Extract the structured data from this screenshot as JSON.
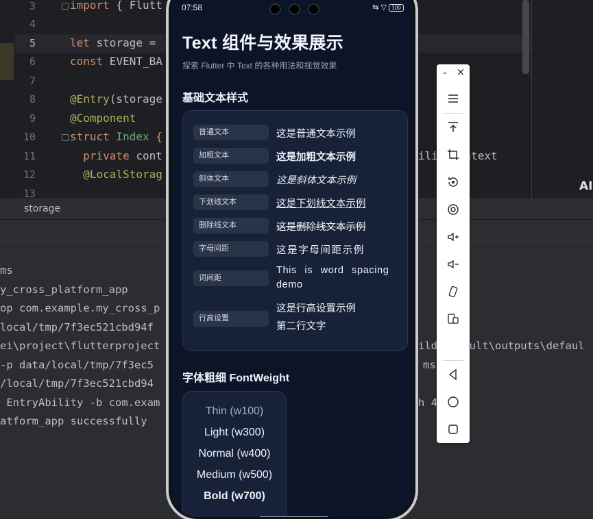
{
  "ide": {
    "line_numbers": [
      "3",
      "4",
      "5",
      "6",
      "7",
      "8",
      "9",
      "10",
      "11",
      "12",
      "13"
    ],
    "code": {
      "l3_kw": "import",
      "l3_rest": " { Flutt",
      "l5_kw": "let",
      "l5_rest": " storage = ",
      "l6_kw": "const",
      "l6_rest": " EVENT_BA",
      "l8_an": "@Entry",
      "l8_rest": "(storage",
      "l9_an": "@Component",
      "l10_kw": "struct",
      "l10_ty": " Index ",
      "l10_rest": "{",
      "l11_kw": "  private",
      "l11_rest": " cont",
      "l11_right": "ilityContext",
      "l12_an": "  @LocalStorag"
    },
    "right_pane_text": "AI",
    "breadcrumb": "storage",
    "console_lines": [
      "ms",
      "y_cross_platform_app",
      "op com.example.my_cross_p",
      "local/tmp/7f3ec521cbd94f",
      "ei\\project\\flutterproject",
      "-p data/local/tmp/7f3ec5",
      "/local/tmp/7f3ec521cbd94",
      " EntryAbility -b com.exam",
      "atform_app successfully "
    ],
    "console_right": [
      "ild\\default\\outputs\\defaul",
      "ms",
      "h 4 ms"
    ]
  },
  "phone": {
    "status_time": "07:58",
    "status_icons": "⇆ ▽",
    "battery": "100",
    "title": "Text 组件与效果展示",
    "subtitle": "探索 Flutter 中 Text 的各种用法和视觉效果",
    "basic_section_title": "基础文本样式",
    "rows": [
      {
        "label": "普通文本",
        "sample": "这是普通文本示例"
      },
      {
        "label": "加粗文本",
        "sample": "这是加粗文本示例"
      },
      {
        "label": "斜体文本",
        "sample": "这是斜体文本示例"
      },
      {
        "label": "下划线文本",
        "sample": "这是下划线文本示例"
      },
      {
        "label": "删除线文本",
        "sample": "这是删除线文本示例"
      },
      {
        "label": "字母间距",
        "sample": "这是字母间距示例"
      },
      {
        "label": "词间距",
        "sample": "This is word spacing demo"
      },
      {
        "label": "行高设置",
        "sample_line1": "这是行高设置示例",
        "sample_line2": "第二行文字"
      }
    ],
    "weight_section_title": "字体粗细 FontWeight",
    "weights": [
      {
        "label": "Thin (w100)",
        "weight": 100
      },
      {
        "label": "Light (w300)",
        "weight": 300
      },
      {
        "label": "Normal (w400)",
        "weight": 400
      },
      {
        "label": "Medium (w500)",
        "weight": 500
      },
      {
        "label": "Bold (w700)",
        "weight": 700
      }
    ]
  },
  "toolbar": {
    "minimize": "-",
    "close": "×",
    "buttons": [
      "menu-icon",
      "pin-top-icon",
      "crop-icon",
      "rotate-icon",
      "screenshot-icon",
      "volume-up-icon",
      "volume-down-icon",
      "rotate-device-icon",
      "multi-screen-icon",
      "back-icon",
      "home-icon",
      "recents-icon"
    ]
  },
  "colors": {
    "ide_bg": "#1e1f22",
    "phone_bg": "#0c1428",
    "card_bg": "#172238",
    "keyword": "#cf8e6d",
    "annotation": "#b3ae60",
    "type": "#6aab73"
  }
}
